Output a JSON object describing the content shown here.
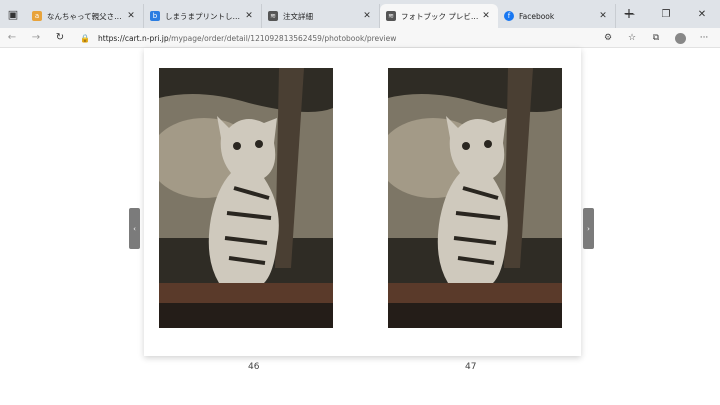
{
  "browser": {
    "tabs": [
      {
        "title": "なんちゃって親父さんの落日記 ·",
        "favicon_color": "#e8a33b",
        "favicon": "a"
      },
      {
        "title": "しまうまプリントしまうま - Bing",
        "favicon_color": "#2b7de1",
        "favicon": "b"
      },
      {
        "title": "注文詳細",
        "favicon_color": "#555555",
        "favicon": "≋"
      },
      {
        "title": "フォトブック プレビュー",
        "favicon_color": "#555555",
        "favicon": "≋",
        "active": true
      },
      {
        "title": "Facebook",
        "favicon_color": "#1877f2",
        "favicon": "f"
      }
    ],
    "close_glyph": "✕",
    "new_tab_glyph": "+",
    "window_controls": {
      "minimize": "—",
      "maximize": "❐",
      "close": "✕"
    },
    "address": {
      "host": "https://cart.n-pri.jp",
      "path": "/mypage/order/detail/121092813562459/photobook/preview"
    }
  },
  "preview": {
    "left_page_number": "46",
    "right_page_number": "47",
    "prev_arrow": "‹",
    "next_arrow": "›"
  }
}
